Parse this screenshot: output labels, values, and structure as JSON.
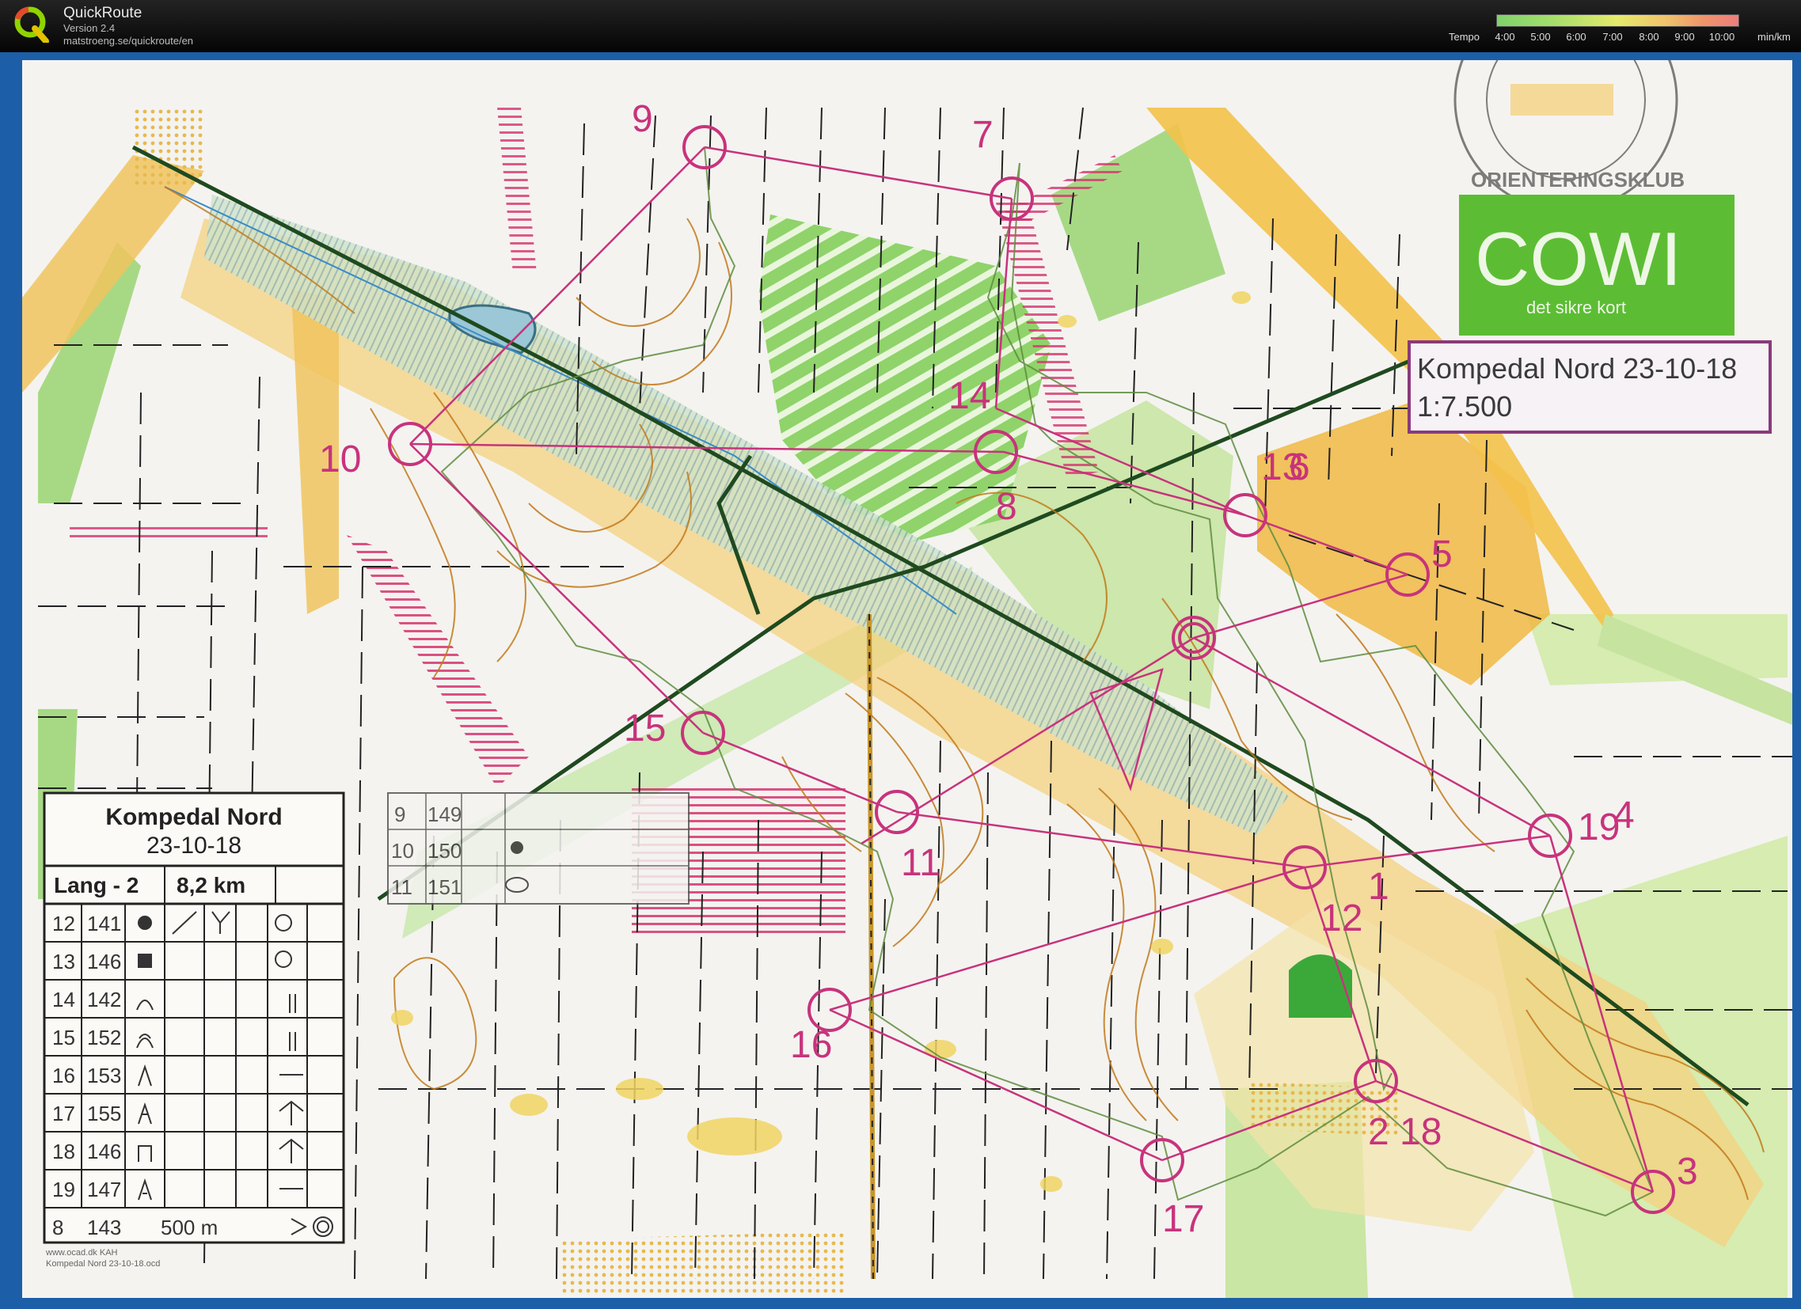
{
  "app": {
    "title": "QuickRoute",
    "version": "Version 2.4",
    "url": "matstroeng.se/quickroute/en"
  },
  "tempo_legend": {
    "label": "Tempo",
    "ticks": [
      "4:00",
      "5:00",
      "6:00",
      "7:00",
      "8:00",
      "9:00",
      "10:00"
    ],
    "unit": "min/km"
  },
  "map": {
    "sponsor": "COWI",
    "sponsor_tagline": "det sikre kort",
    "club_stamp": "ORIENTERINGSKLUB",
    "title_box": {
      "line1": "Kompedal Nord 23-10-18",
      "line2": "1:7.500"
    },
    "control_labels": [
      "9",
      "7",
      "10",
      "14",
      "8",
      "13",
      "6",
      "5",
      "15",
      "11",
      "19",
      "4",
      "12",
      "1",
      "16",
      "2",
      "18",
      "17",
      "3"
    ],
    "description_sheet": {
      "title": "Kompedal Nord",
      "date": "23-10-18",
      "course": "Lang - 2",
      "distance": "8,2 km",
      "rows": [
        {
          "num": "12",
          "code": "141"
        },
        {
          "num": "13",
          "code": "146"
        },
        {
          "num": "14",
          "code": "142"
        },
        {
          "num": "15",
          "code": "152"
        },
        {
          "num": "16",
          "code": "153"
        },
        {
          "num": "17",
          "code": "155"
        },
        {
          "num": "18",
          "code": "146"
        },
        {
          "num": "19",
          "code": "147"
        }
      ],
      "last_num": "8",
      "last_code": "143",
      "finish_distance": "500 m"
    },
    "small_sheet": {
      "rows": [
        {
          "num": "9",
          "code": "149"
        },
        {
          "num": "10",
          "code": "150"
        },
        {
          "num": "11",
          "code": "151"
        }
      ]
    },
    "footer_note_1": "www.ocad.dk  KAH",
    "footer_note_2": "Kompedal Nord 23-10-18.ocd"
  }
}
